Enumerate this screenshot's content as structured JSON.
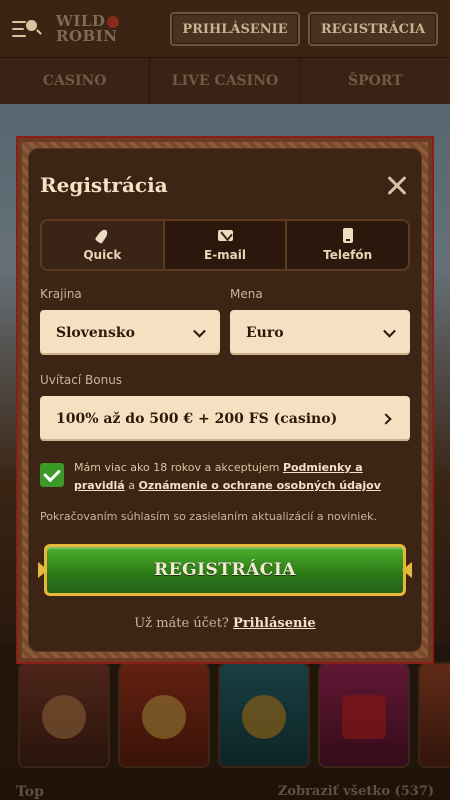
{
  "header": {
    "logo_line1": "WILD",
    "logo_line2": "ROBIN",
    "login_label": "PRIHLÁSENIE",
    "register_label": "REGISTRÁCIA"
  },
  "nav": {
    "items": [
      "CASINO",
      "LIVE CASINO",
      "ŠPORT"
    ]
  },
  "background": {
    "section_title": "Top",
    "see_all": "Zobraziť všetko (537)"
  },
  "modal": {
    "title": "Registrácia",
    "tabs": [
      {
        "label": "Quick",
        "icon": "rocket-icon"
      },
      {
        "label": "E-mail",
        "icon": "envelope-icon"
      },
      {
        "label": "Telefón",
        "icon": "phone-icon"
      }
    ],
    "country_label": "Krajina",
    "country_value": "Slovensko",
    "currency_label": "Mena",
    "currency_value": "Euro",
    "bonus_label": "Uvítací Bonus",
    "bonus_value": "100% až do 500 € + 200 FS (casino)",
    "consent_checked": true,
    "consent_text_1": "Mám viac ako 18 rokov a akceptujem",
    "consent_link_1": "Podmienky a pravidlá",
    "consent_text_2": "a",
    "consent_link_2": "Oznámenie o ochrane osobných údajov",
    "info_text": "Pokračovaním súhlasím so zasielaním aktualizácií a noviniek.",
    "submit_label": "REGISTRÁCIA",
    "login_prompt": "Už máte účet?",
    "login_link": "Prihlásenie"
  },
  "colors": {
    "accent_green": "#3b9a27",
    "gold": "#e7b73a",
    "modal_bg": "#3d2414",
    "input_bg": "#f7e0c2"
  }
}
